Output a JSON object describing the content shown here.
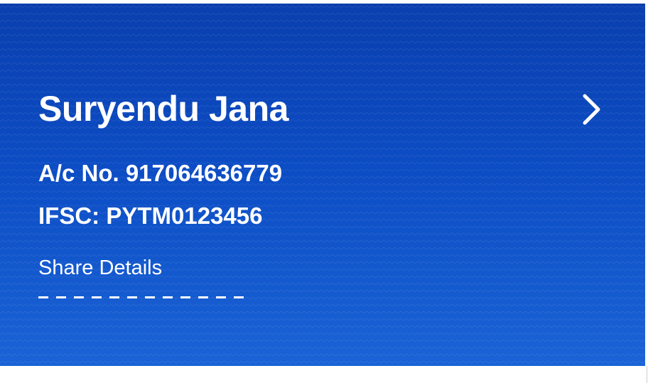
{
  "account_card": {
    "holder_name": "Suryendu Jana",
    "account_number": "A/c No. 917064636779",
    "ifsc": "IFSC: PYTM0123456",
    "share_label": "Share Details",
    "navigate_icon": "chevron-right-icon"
  },
  "colors": {
    "card_top": "#0a3fae",
    "card_bottom": "#1a63d6",
    "text": "#ffffff",
    "page_background": "#ffffff"
  }
}
